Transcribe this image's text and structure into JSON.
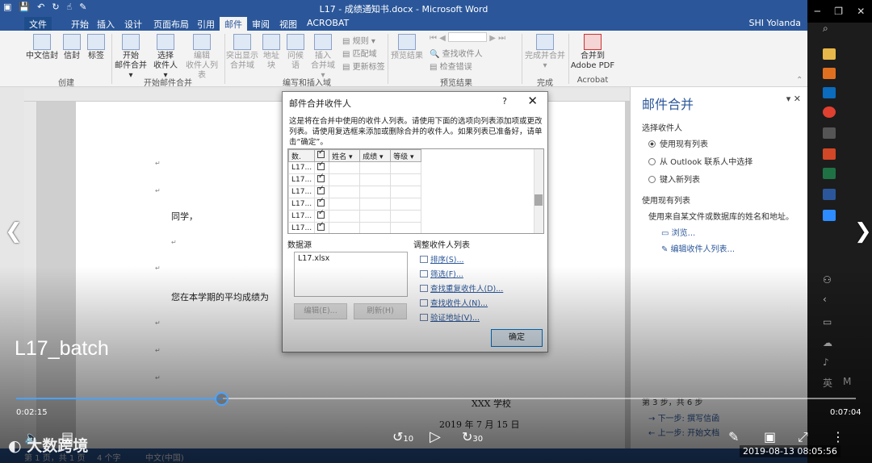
{
  "word": {
    "title": "L17 - 成绩通知书.docx - Microsoft Word",
    "user": "SHI Yolanda",
    "tabs": [
      "文件",
      "开始",
      "插入",
      "设计",
      "页面布局",
      "引用",
      "邮件",
      "审阅",
      "视图",
      "ACROBAT"
    ],
    "active_tab": "邮件",
    "ribbon": {
      "create": {
        "label": "创建",
        "buttons": [
          "中文信封",
          "信封",
          "标签"
        ]
      },
      "start": {
        "label": "开始邮件合并",
        "buttons": [
          "开始\n邮件合并 ▾",
          "选择\n收件人 ▾",
          "编辑\n收件人列表"
        ]
      },
      "write": {
        "label": "编写和插入域",
        "buttons": [
          "突出显示\n合并域",
          "地址块",
          "问候语",
          "插入\n合并域 ▾"
        ],
        "small": [
          "规则 ▾",
          "匹配域",
          "更新标签"
        ]
      },
      "preview": {
        "label": "预览结果",
        "buttons": [
          "预览结果"
        ],
        "small": [
          "查找收件人",
          "检查错误"
        ]
      },
      "finish": {
        "label": "完成",
        "buttons": [
          "完成并合并\n▾"
        ]
      },
      "acrobat": {
        "label": "Acrobat",
        "buttons": [
          "合并到\nAdobe PDF"
        ]
      }
    },
    "document": {
      "greeting": "同学，",
      "body": "您在本学期的平均成绩为",
      "school": "XXX 学校",
      "date": "2019 年 7 月 15 日"
    },
    "status": {
      "page": "第 1 页，共 1 页",
      "words": "4 个字",
      "lang": "中文(中国)"
    }
  },
  "task_pane": {
    "title": "邮件合并",
    "section_select": "选择收件人",
    "options": [
      "使用现有列表",
      "从 Outlook 联系人中选择",
      "键入新列表"
    ],
    "selected_option": 0,
    "section_use": "使用现有列表",
    "use_desc": "使用来自某文件或数据库的姓名和地址。",
    "browse": "浏览...",
    "edit_list": "编辑收件人列表...",
    "step": "第 3 步，共 6 步",
    "next": "下一步: 撰写信函",
    "prev": "上一步: 开始文档"
  },
  "dialog": {
    "title": "邮件合并收件人",
    "help": "?",
    "close": "✕",
    "description": "这是将在合并中使用的收件人列表。请使用下面的选项向列表添加项或更改列表。请使用复选框来添加或删除合并的收件人。如果列表已准备好，请单击“确定”。",
    "columns": [
      "数.",
      "",
      "姓名",
      "成绩",
      "等级"
    ],
    "rows": [
      {
        "src": "L17...",
        "checked": true
      },
      {
        "src": "L17...",
        "checked": true
      },
      {
        "src": "L17...",
        "checked": true
      },
      {
        "src": "L17...",
        "checked": true
      },
      {
        "src": "L17...",
        "checked": true
      },
      {
        "src": "L17...",
        "checked": true
      }
    ],
    "datasource_label": "数据源",
    "datasource_item": "L17.xlsx",
    "edit_btn": "编辑(E)...",
    "refresh_btn": "刷新(H)",
    "adjust_label": "调整收件人列表",
    "links": [
      "排序(S)...",
      "筛选(F)...",
      "查找重复收件人(D)...",
      "查找收件人(N)...",
      "验证地址(V)..."
    ],
    "ok": "确定"
  },
  "video": {
    "title": "L17_batch",
    "elapsed": "0:02:15",
    "duration": "0:07:04",
    "progress": 0.246,
    "rewind": "10",
    "forward": "30",
    "watermark": "大数跨境",
    "timestamp": "2019-08-13 08:05:56"
  },
  "taskbar": {
    "lang": "英",
    "ime": "M"
  },
  "colors": {
    "word_blue": "#2b579a",
    "progress": "#4aa3ff"
  }
}
